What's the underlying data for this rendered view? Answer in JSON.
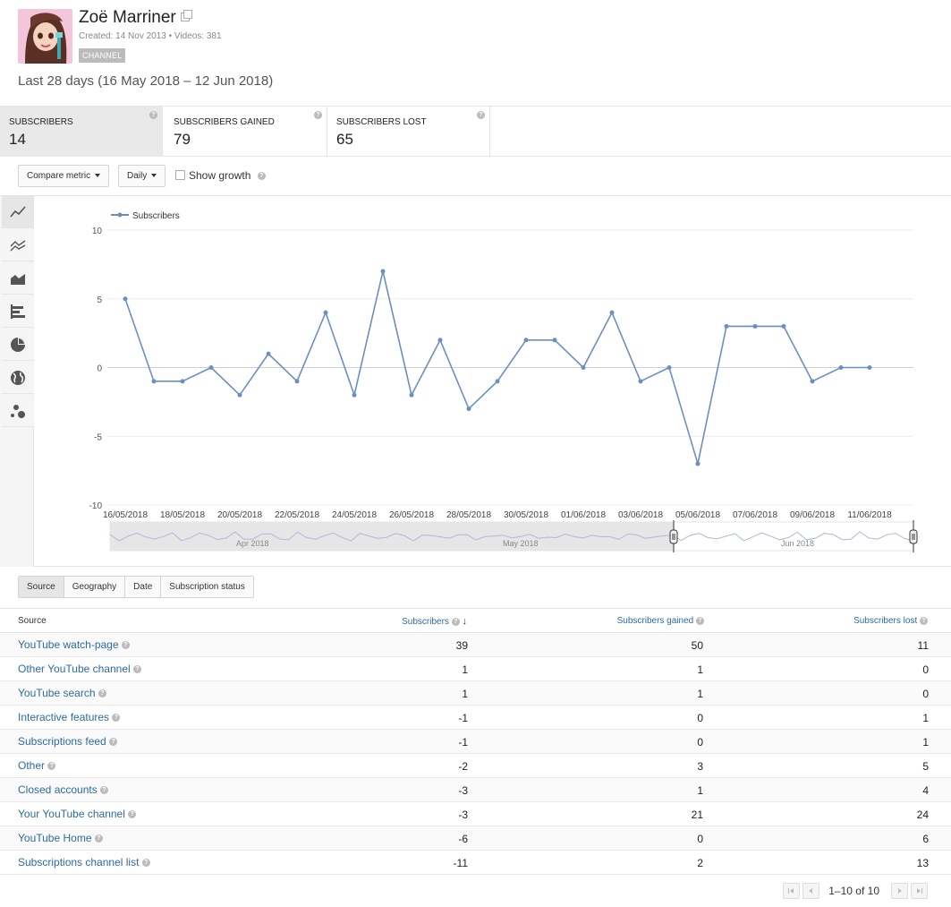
{
  "channel": {
    "name": "Zoë Marriner",
    "meta": "Created: 14 Nov 2013  •  Videos: 381",
    "badge": "CHANNEL",
    "date_range": "Last 28 days (16 May 2018 – 12 Jun 2018)"
  },
  "metrics": [
    {
      "label": "SUBSCRIBERS",
      "value": "14"
    },
    {
      "label": "SUBSCRIBERS GAINED",
      "value": "79"
    },
    {
      "label": "SUBSCRIBERS LOST",
      "value": "65"
    }
  ],
  "controls": {
    "compare_metric": "Compare metric",
    "interval": "Daily",
    "show_growth": "Show growth"
  },
  "chart_data": {
    "type": "line",
    "legend": "Subscribers",
    "legend_position": "top-left",
    "ylim": [
      -10,
      10
    ],
    "yticks": [
      "10",
      "5",
      "0",
      "-5",
      "-10"
    ],
    "x": [
      "16/05/2018",
      "17/05/2018",
      "18/05/2018",
      "19/05/2018",
      "20/05/2018",
      "21/05/2018",
      "22/05/2018",
      "23/05/2018",
      "24/05/2018",
      "25/05/2018",
      "26/05/2018",
      "27/05/2018",
      "28/05/2018",
      "29/05/2018",
      "30/05/2018",
      "31/05/2018",
      "01/06/2018",
      "02/06/2018",
      "03/06/2018",
      "04/06/2018",
      "05/06/2018",
      "06/06/2018",
      "07/06/2018",
      "08/06/2018",
      "09/06/2018",
      "10/06/2018",
      "11/06/2018"
    ],
    "xtick_labels": [
      "16/05/2018",
      "18/05/2018",
      "20/05/2018",
      "22/05/2018",
      "24/05/2018",
      "26/05/2018",
      "28/05/2018",
      "30/05/2018",
      "01/06/2018",
      "03/06/2018",
      "05/06/2018",
      "07/06/2018",
      "09/06/2018",
      "11/06/2018"
    ],
    "series": [
      {
        "name": "Subscribers",
        "values": [
          5,
          -1,
          -1,
          0,
          -2,
          1,
          -1,
          4,
          -2,
          7,
          -2,
          2,
          -3,
          -1,
          2,
          2,
          0,
          4,
          -1,
          0,
          -7,
          3,
          3,
          3,
          -1,
          0,
          0
        ]
      }
    ],
    "navigator_labels": [
      "Apr 2018",
      "May 2018",
      "Jun 2018"
    ],
    "grid": true,
    "color": "#6b8fc4"
  },
  "table_tabs": [
    "Source",
    "Geography",
    "Date",
    "Subscription status"
  ],
  "table": {
    "headers": [
      "Source",
      "Subscribers",
      "Subscribers gained",
      "Subscribers lost"
    ],
    "rows": [
      [
        "YouTube watch-page",
        "39",
        "50",
        "11"
      ],
      [
        "Other YouTube channel",
        "1",
        "1",
        "0"
      ],
      [
        "YouTube search",
        "1",
        "1",
        "0"
      ],
      [
        "Interactive features",
        "-1",
        "0",
        "1"
      ],
      [
        "Subscriptions feed",
        "-1",
        "0",
        "1"
      ],
      [
        "Other",
        "-2",
        "3",
        "5"
      ],
      [
        "Closed accounts",
        "-3",
        "1",
        "4"
      ],
      [
        "Your YouTube channel",
        "-3",
        "21",
        "24"
      ],
      [
        "YouTube Home",
        "-6",
        "0",
        "6"
      ],
      [
        "Subscriptions channel list",
        "-11",
        "2",
        "13"
      ]
    ]
  },
  "pager": {
    "range": "1–10 of",
    "total": "10"
  }
}
